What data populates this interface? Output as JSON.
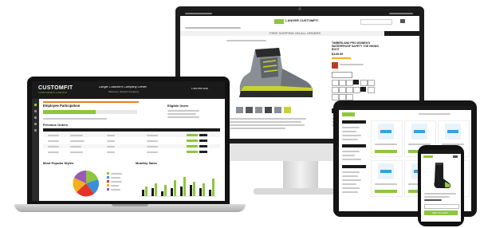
{
  "laptop": {
    "logo": "CUSTOMFIT",
    "logo_sub": "CORPORATE CENTER",
    "header_title": "Langer CustomFit Company Center",
    "header_subtitle": "Welcome, Sample Company",
    "header_phone": "1 800 555 0199",
    "section_title": "Employee Participation",
    "right_title": "Eligible Users",
    "previous_orders_title": "Previous Orders",
    "chart_left_title": "Most Popular Styles",
    "chart_right_title": "Monthly Sales"
  },
  "monitor": {
    "logo_text": "LANGER CUSTOMFIT",
    "promo": "FREE SHIPPING ON ALL ORDERS",
    "product_title": "TIMBERLAND PRO WOMEN'S WATERPROOF SAFETY TOE HIKING BOOT",
    "price": "$149.99",
    "add_to_cart": "ADD TO CART"
  },
  "tablet": {
    "add_label": "ADD TO CART"
  },
  "phone": {
    "add_label": "ADD TO CART"
  },
  "colors": {
    "lime": "#8dc63f",
    "dark": "#1a1a1a",
    "boot_grey": "#8a8f96",
    "boot_accent": "#c9d230"
  }
}
